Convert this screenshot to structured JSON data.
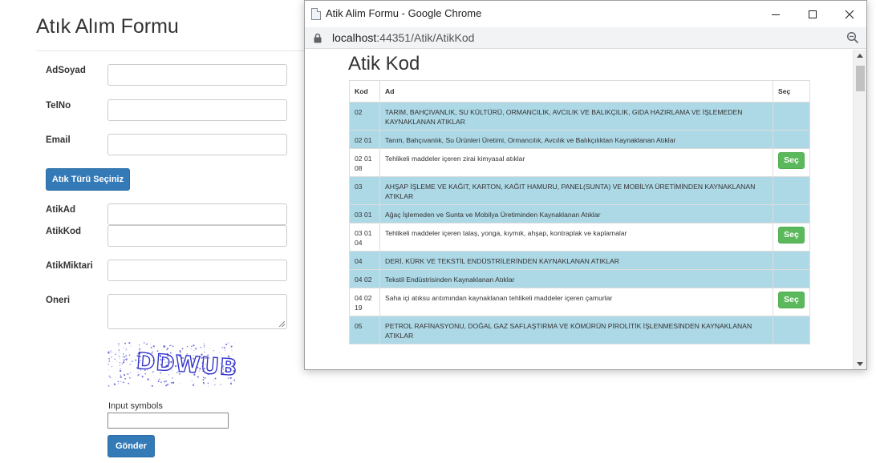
{
  "form": {
    "title": "Atık Alım Formu",
    "labels": {
      "adsoyad": "AdSoyad",
      "telno": "TelNo",
      "email": "Email",
      "atikad": "AtikAd",
      "atikkod": "AtikKod",
      "atikmiktari": "AtikMiktari",
      "oneri": "Oneri"
    },
    "atik_turu_button": "Atık Türü Seçiniz",
    "captcha_text": "DDWUB",
    "captcha_label": "Input symbols",
    "submit_button": "Gönder"
  },
  "popup": {
    "window_title": "Atik Alim Formu - Google Chrome",
    "url_host": "localhost",
    "url_rest": ":44351/Atik/AtikKod",
    "heading": "Atik Kod",
    "table": {
      "headers": [
        "Kod",
        "Ad",
        "Seç"
      ],
      "select_label": "Seç",
      "rows": [
        {
          "kod": "02",
          "ad": "TARIM, BAHÇIVANLIK, SU KÜLTÜRÜ, ORMANCILIK, AVCILIK VE BALIKÇILIK, GIDA HAZIRLAMA VE İŞLEMEDEN KAYNAKLANAN ATIKLAR",
          "highlight": true,
          "selectable": false
        },
        {
          "kod": "02 01",
          "ad": "Tarım, Bahçıvanlık, Su Ürünleri Üretimi, Ormancılık, Avcılık ve Balıkçılıktan Kaynaklanan Atıklar",
          "highlight": true,
          "selectable": false
        },
        {
          "kod": "02 01 08",
          "ad": "Tehlikeli maddeler içeren zirai kimyasal atıklar",
          "highlight": false,
          "selectable": true
        },
        {
          "kod": "03",
          "ad": "AHŞAP İŞLEME VE KAĞIT, KARTON, KAĞIT HAMURU, PANEL(SUNTA) VE MOBİLYA ÜRETİMİNDEN KAYNAKLANAN ATIKLAR",
          "highlight": true,
          "selectable": false
        },
        {
          "kod": "03 01",
          "ad": "Ağaç İşlemeden ve Sunta ve Mobilya Üretiminden Kaynaklanan Atıklar",
          "highlight": true,
          "selectable": false
        },
        {
          "kod": "03 01 04",
          "ad": "Tehlikeli maddeler içeren talaş, yonga, kıymık, ahşap, kontraplak ve kaplamalar",
          "highlight": false,
          "selectable": true
        },
        {
          "kod": "04",
          "ad": "DERİ, KÜRK VE TEKSTİL ENDÜSTRİLERİNDEN KAYNAKLANAN ATIKLAR",
          "highlight": true,
          "selectable": false
        },
        {
          "kod": "04 02",
          "ad": "Tekstil Endüstrisinden Kaynaklanan Atıklar",
          "highlight": true,
          "selectable": false
        },
        {
          "kod": "04 02 19",
          "ad": "Saha içi atıksu arıtımından kaynaklanan tehlikeli maddeler içeren çamurlar",
          "highlight": false,
          "selectable": true
        },
        {
          "kod": "05",
          "ad": "PETROL RAFİNASYONU, DOĞAL GAZ SAFLAŞTIRMA VE KÖMÜRÜN PİROLİTİK İŞLENMESİNDEN KAYNAKLANAN ATIKLAR",
          "highlight": true,
          "selectable": false
        }
      ]
    }
  },
  "colors": {
    "primary_button": "#337ab7",
    "select_button": "#5cb85c",
    "row_highlight": "#add8e6"
  }
}
